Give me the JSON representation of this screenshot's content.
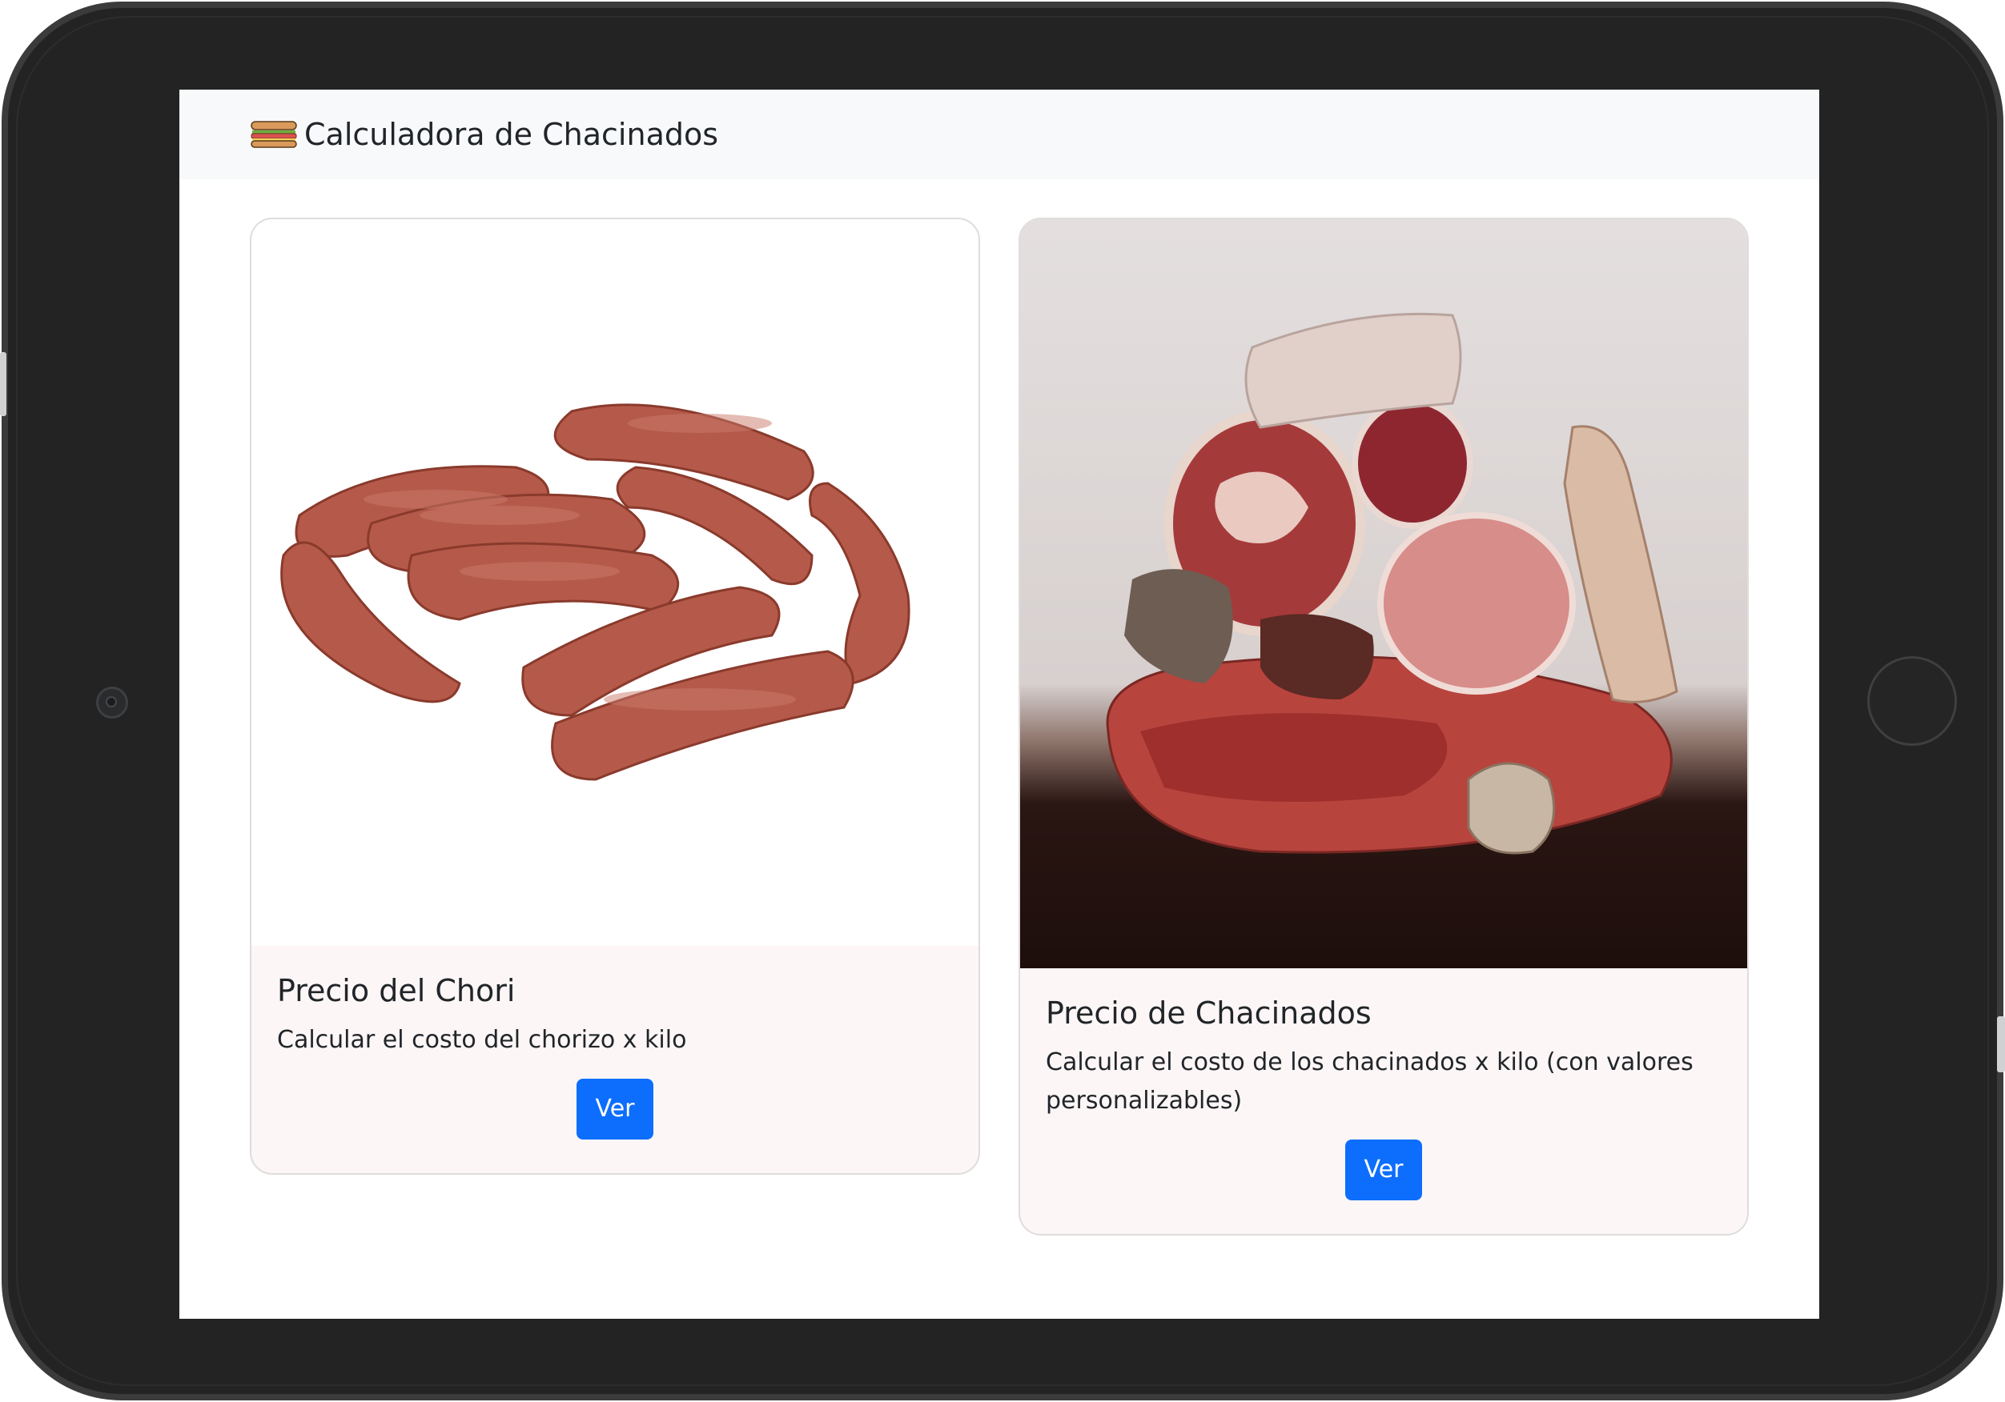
{
  "app": {
    "brand_icon": "sandwich-icon",
    "title": "Calculadora de Chacinados"
  },
  "cards": [
    {
      "image": "chorizo-sausages-image",
      "title": "Precio del Chori",
      "text": "Calcular el costo del chorizo x kilo",
      "button_label": "Ver"
    },
    {
      "image": "charcuterie-meats-image",
      "title": "Precio de Chacinados",
      "text": "Calcular el costo de los chacinados x kilo (con valores personalizables)",
      "button_label": "Ver"
    }
  ],
  "colors": {
    "accent": "#0d6efd",
    "navbar_bg": "#f8f9fa",
    "card_bg": "#fcf6f6",
    "device_frame": "#222322"
  }
}
